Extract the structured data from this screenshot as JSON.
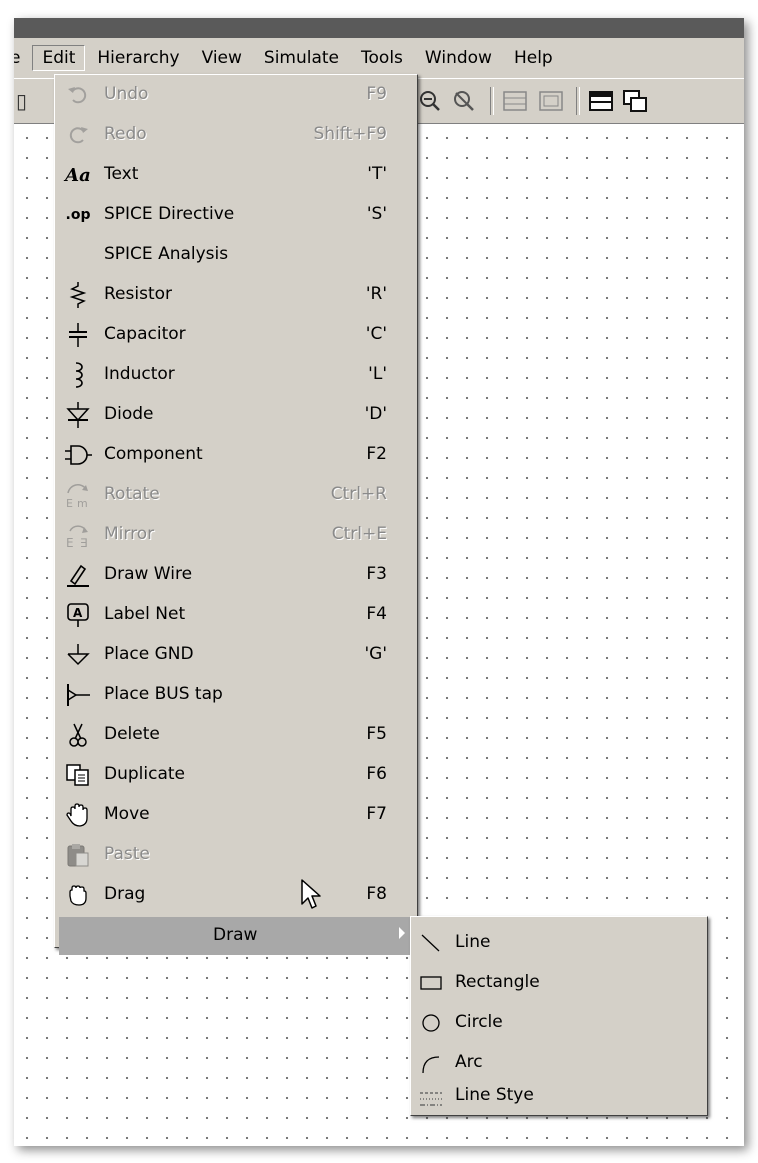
{
  "menubar": {
    "items": [
      {
        "label": "e"
      },
      {
        "label": "Edit"
      },
      {
        "label": "Hierarchy"
      },
      {
        "label": "View"
      },
      {
        "label": "Simulate"
      },
      {
        "label": "Tools"
      },
      {
        "label": "Window"
      },
      {
        "label": "Help"
      }
    ]
  },
  "edit_menu": {
    "items": [
      {
        "label": "Undo",
        "shortcut": "F9",
        "icon": "undo-icon",
        "disabled": true
      },
      {
        "label": "Redo",
        "shortcut": "Shift+F9",
        "icon": "redo-icon",
        "disabled": true
      },
      {
        "label": "Text",
        "shortcut": "'T'",
        "icon": "text-icon",
        "disabled": false
      },
      {
        "label": "SPICE Directive",
        "shortcut": "'S'",
        "icon": "spice-directive-icon",
        "icon_text": ".op",
        "disabled": false
      },
      {
        "label": "SPICE Analysis",
        "shortcut": "",
        "icon": "",
        "disabled": false
      },
      {
        "label": "Resistor",
        "shortcut": "'R'",
        "icon": "resistor-icon",
        "disabled": false
      },
      {
        "label": "Capacitor",
        "shortcut": "'C'",
        "icon": "capacitor-icon",
        "disabled": false
      },
      {
        "label": "Inductor",
        "shortcut": "'L'",
        "icon": "inductor-icon",
        "disabled": false
      },
      {
        "label": "Diode",
        "shortcut": "'D'",
        "icon": "diode-icon",
        "disabled": false
      },
      {
        "label": "Component",
        "shortcut": "F2",
        "icon": "component-icon",
        "disabled": false
      },
      {
        "label": "Rotate",
        "shortcut": "Ctrl+R",
        "icon": "rotate-icon",
        "disabled": true
      },
      {
        "label": "Mirror",
        "shortcut": "Ctrl+E",
        "icon": "mirror-icon",
        "disabled": true
      },
      {
        "label": "Draw Wire",
        "shortcut": "F3",
        "icon": "wire-pencil-icon",
        "disabled": false
      },
      {
        "label": "Label Net",
        "shortcut": "F4",
        "icon": "label-net-icon",
        "disabled": false
      },
      {
        "label": "Place GND",
        "shortcut": "'G'",
        "icon": "ground-icon",
        "disabled": false
      },
      {
        "label": "Place BUS tap",
        "shortcut": "",
        "icon": "bus-tap-icon",
        "disabled": false
      },
      {
        "label": "Delete",
        "shortcut": "F5",
        "icon": "scissors-icon",
        "disabled": false
      },
      {
        "label": "Duplicate",
        "shortcut": "F6",
        "icon": "duplicate-icon",
        "disabled": false
      },
      {
        "label": "Move",
        "shortcut": "F7",
        "icon": "move-hand-icon",
        "disabled": false
      },
      {
        "label": "Paste",
        "shortcut": "",
        "icon": "paste-icon",
        "disabled": true
      },
      {
        "label": "Drag",
        "shortcut": "F8",
        "icon": "drag-hand-icon",
        "disabled": false
      }
    ],
    "draw": {
      "label": "Draw"
    }
  },
  "draw_submenu": {
    "items": [
      {
        "label": "Line",
        "icon": "line-icon"
      },
      {
        "label": "Rectangle",
        "icon": "rectangle-icon"
      },
      {
        "label": "Circle",
        "icon": "circle-icon"
      },
      {
        "label": "Arc",
        "icon": "arc-icon"
      },
      {
        "label": "Line Stye",
        "icon": "line-style-icon"
      }
    ]
  }
}
